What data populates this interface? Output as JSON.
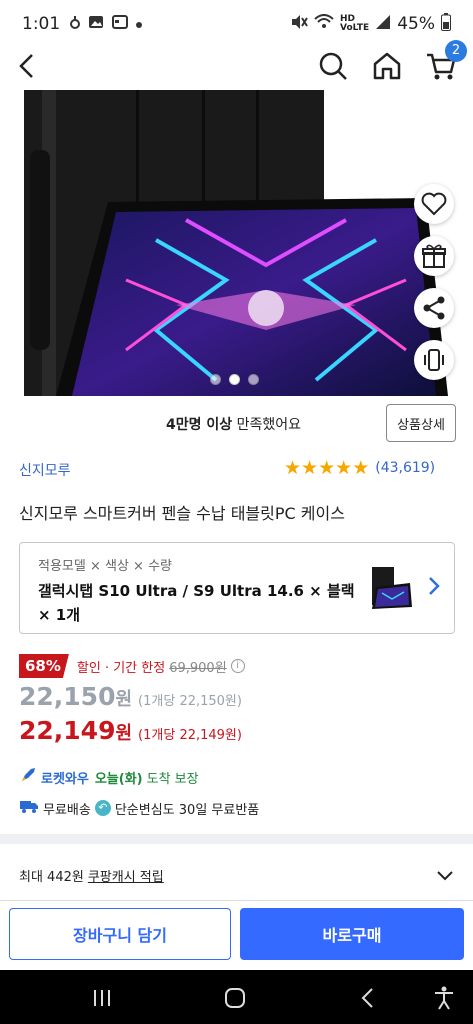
{
  "status_bar": {
    "time": "1:01",
    "battery": "45%",
    "icons": [
      "notification-dot-icon",
      "image-icon",
      "calendar-icon",
      "silent-icon",
      "wifi-icon",
      "hd-voice-icon",
      "signal-icon",
      "battery-icon"
    ]
  },
  "top_nav": {
    "cart_count": "2",
    "icons": [
      "back-arrow-icon",
      "search-icon",
      "home-icon",
      "cart-icon"
    ]
  },
  "hero": {
    "side_icons": [
      "heart-icon",
      "gift-icon",
      "share-icon",
      "vibrate-icon"
    ],
    "dots_count": 3,
    "active_dot": 2
  },
  "satisfaction": {
    "bold": "4만명 이상",
    "rest": " 만족했어요",
    "detail_button": "상품상세"
  },
  "product": {
    "brand": "신지모루",
    "rating_stars": 5,
    "review_count": "(43,619)",
    "title": "신지모루 스마트커버 펜슬 수납 태블릿PC 케이스"
  },
  "option": {
    "label": "적용모델 × 색상 × 수량",
    "value": "갤럭시탭 S10 Ultra / S9 Ultra 14.6 × 블랙 × 1개"
  },
  "pricing": {
    "discount_badge": "68%",
    "promo_text": "할인 · 기간 한정",
    "original_price": "69,900원",
    "price_gray_amount": "22,150",
    "price_gray_unit": "원",
    "price_gray_per": "(1개당 22,150원)",
    "price_red_amount": "22,149",
    "price_red_unit": "원",
    "price_red_per": "(1개당 22,149원)"
  },
  "delivery": {
    "rocket": "로켓와우",
    "day": "오늘(화)",
    "rest": "도착 보장",
    "free_shipping": "무료배송",
    "return_policy": "단순변심도 30일 무료반품"
  },
  "cash": {
    "prefix": "최대 442원",
    "link": "쿠팡캐시 적립"
  },
  "bottom": {
    "cart_button": "장바구니 담기",
    "buy_button": "바로구매"
  },
  "colors": {
    "accent_blue": "#346aff",
    "discount_red": "#c8161d",
    "star": "#f6a700",
    "brand_link": "#3566c8",
    "arrival_green": "#1e8a3a"
  }
}
